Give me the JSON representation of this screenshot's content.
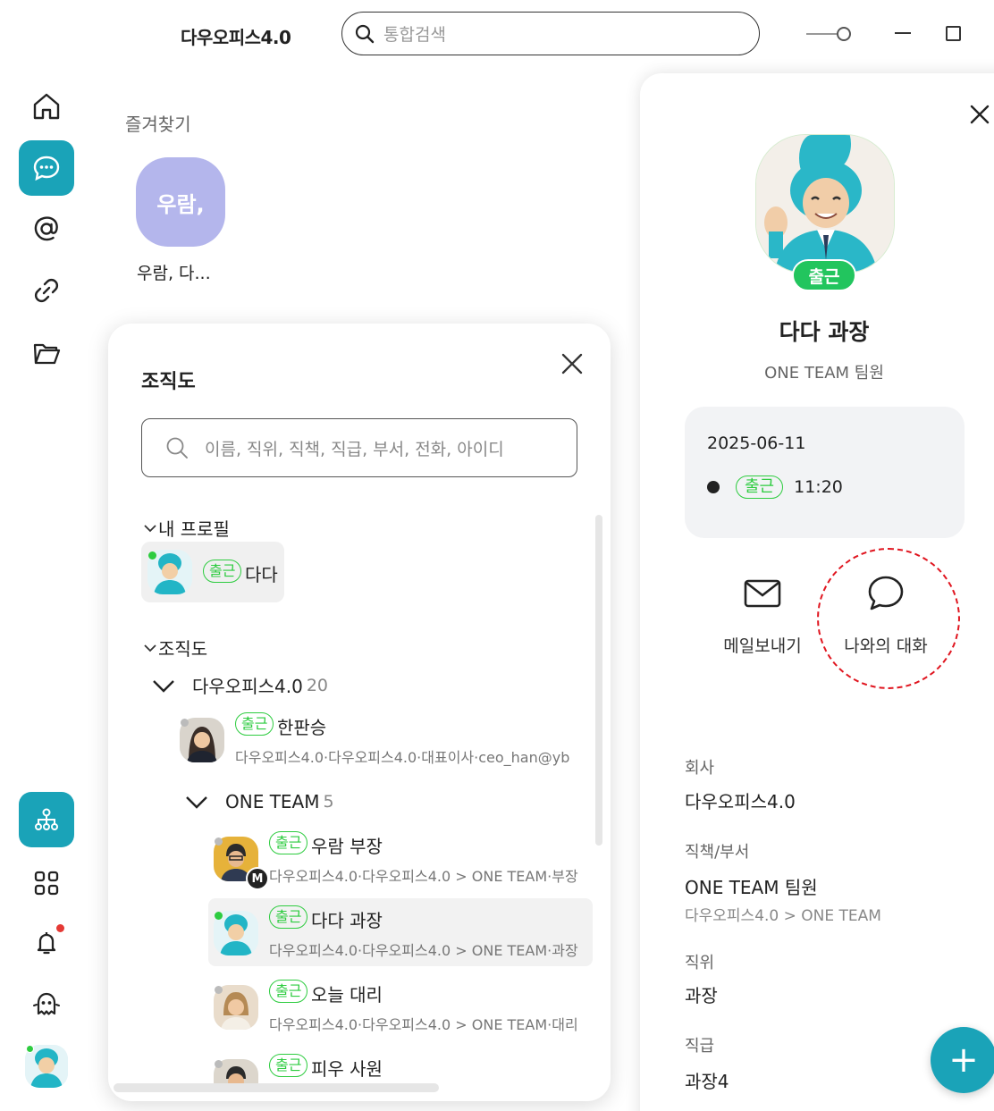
{
  "app": {
    "title": "다우오피스4.0"
  },
  "search": {
    "placeholder": "통합검색"
  },
  "favorites": {
    "title": "즐겨찾기",
    "items": [
      {
        "tile_label": "우람,",
        "name": "우람, 다..."
      }
    ]
  },
  "org": {
    "title": "조직도",
    "search_placeholder": "이름, 직위, 직책, 직급, 부서, 전화, 아이디",
    "my_profile_label": "내 프로필",
    "my_profile": {
      "status": "출근",
      "name": "다다"
    },
    "section_label": "조직도",
    "company": {
      "name": "다우오피스4.0",
      "count": "20"
    },
    "ceo": {
      "status": "출근",
      "name": "한판승",
      "sub": "다우오피스4.0·다우오피스4.0·대표이사·ceo_han@yb"
    },
    "team": {
      "name": "ONE TEAM",
      "count": "5"
    },
    "members": [
      {
        "status": "출근",
        "name": "우람 부장",
        "sub": "다우오피스4.0·다우오피스4.0 > ONE TEAM·부장",
        "badge": "M"
      },
      {
        "status": "출근",
        "name": "다다 과장",
        "sub": "다우오피스4.0·다우오피스4.0 > ONE TEAM·과장"
      },
      {
        "status": "출근",
        "name": "오늘 대리",
        "sub": "다우오피스4.0·다우오피스4.0 > ONE TEAM·대리"
      },
      {
        "status": "출근",
        "name": "피우 사원",
        "sub": ""
      }
    ]
  },
  "profile": {
    "status_badge": "출근",
    "name": "다다 과장",
    "team": "ONE TEAM 팀원",
    "attendance": {
      "date": "2025-06-11",
      "status": "출근",
      "time": "11:20"
    },
    "actions": {
      "mail": "메일보내기",
      "chat": "나와의 대화"
    },
    "info": {
      "company_label": "회사",
      "company_value": "다우오피스4.0",
      "duty_label": "직책/부서",
      "duty_value": "ONE TEAM 팀원",
      "duty_sub": "다우오피스4.0 > ONE TEAM",
      "position_label": "직위",
      "position_value": "과장",
      "grade_label": "직급",
      "grade_value": "과장4"
    },
    "fab": "+"
  },
  "colors": {
    "accent": "#1aa3b8",
    "online": "#2ecc40",
    "highlight_circle": "#e0151f",
    "fav_tile": "#b4b6ec"
  }
}
